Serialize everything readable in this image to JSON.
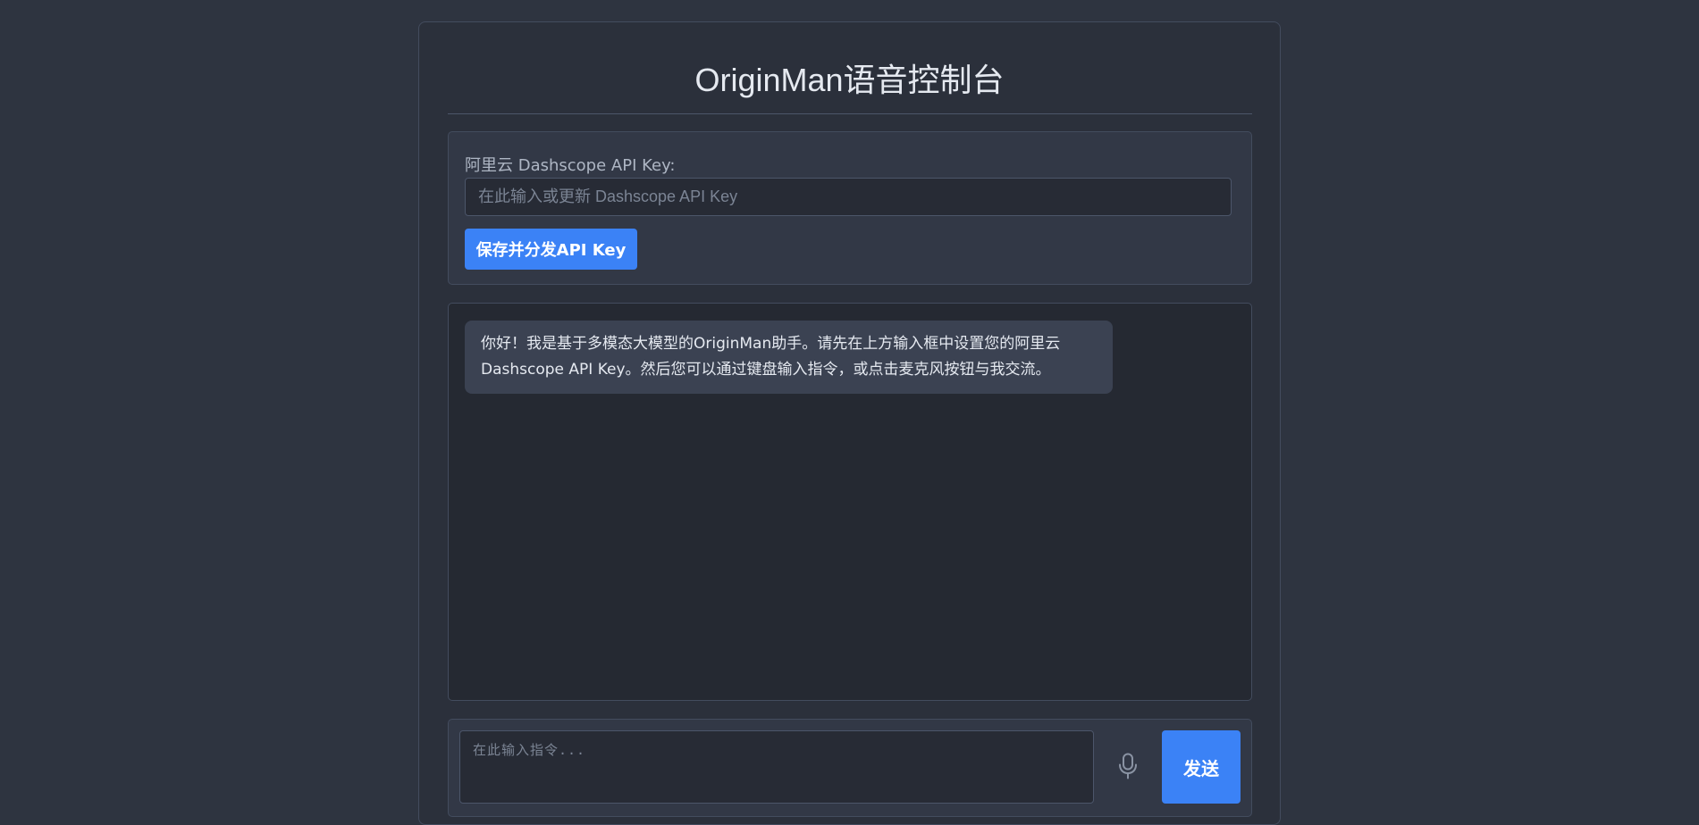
{
  "header": {
    "title": "OriginMan语音控制台"
  },
  "apikey": {
    "label": "阿里云 Dashscope API Key:",
    "placeholder": "在此输入或更新 Dashscope API Key",
    "value": "",
    "save_label": "保存并分发API Key"
  },
  "chat": {
    "messages": [
      {
        "role": "assistant",
        "text": "你好！我是基于多模态大模型的OriginMan助手。请先在上方输入框中设置您的阿里云Dashscope API Key。然后您可以通过键盘输入指令，或点击麦克风按钮与我交流。"
      }
    ]
  },
  "composer": {
    "placeholder": "在此输入指令...",
    "value": "",
    "mic_icon": "microphone-icon",
    "send_label": "发送"
  },
  "colors": {
    "background": "#2e3440",
    "panel": "#323846",
    "chat_background": "#252932",
    "accent": "#3b82f6"
  }
}
